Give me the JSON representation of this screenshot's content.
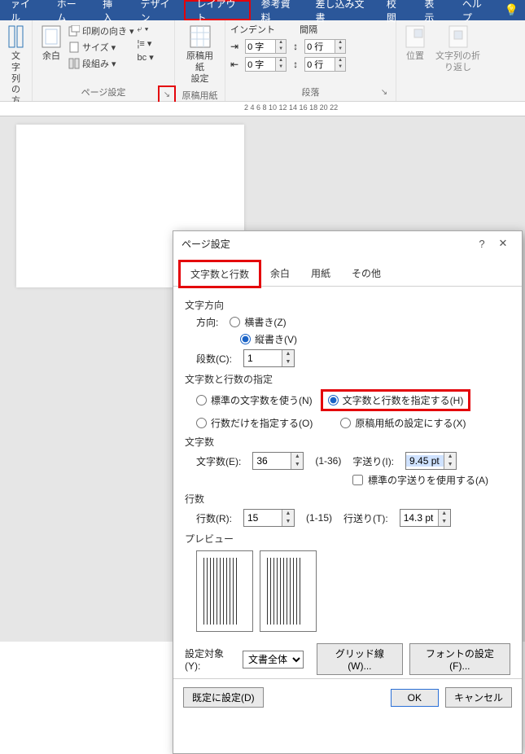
{
  "ribbon_tabs": {
    "file": "ァイル",
    "home": "ホーム",
    "insert": "挿入",
    "design": "デザイン",
    "layout": "レイアウト",
    "references": "参考資料",
    "mailings": "差し込み文書",
    "review": "校閲",
    "view": "表示",
    "help": "ヘルプ"
  },
  "ribbon": {
    "textdir_group": {
      "btn1": "文字列の",
      "btn2": "方向"
    },
    "margins": "余白",
    "orientation": "印刷の向き",
    "size": "サイズ",
    "columns": "段組み",
    "breaks": "",
    "genkou": {
      "l1": "原稿用紙",
      "l2": "設定"
    },
    "page_setup_title": "ページ設定",
    "genkou_title": "原稿用紙",
    "indent_title": "インデント",
    "spacing_title": "間隔",
    "para_title": "段落",
    "indent_left": "0 字",
    "indent_right": "0 字",
    "space_before": "0 行",
    "space_after": "0 行",
    "position": "位置",
    "wrap": {
      "l1": "文字列の折",
      "l2": "り返し"
    }
  },
  "ruler": {
    "marks": "2       4       6       8      10      12      14      16      18     20     22"
  },
  "dialog": {
    "title": "ページ設定",
    "tabs": {
      "grid": "文字数と行数",
      "margins": "余白",
      "paper": "用紙",
      "other": "その他"
    },
    "sect_textdir": "文字方向",
    "direction_label": "方向:",
    "horizontal": "横書き(Z)",
    "vertical": "縦書き(V)",
    "columns_label": "段数(C):",
    "columns_value": "1",
    "sect_spec": "文字数と行数の指定",
    "opt_std": "標準の文字数を使う(N)",
    "opt_chars_lines": "文字数と行数を指定する(H)",
    "opt_lines_only": "行数だけを指定する(O)",
    "opt_genkou": "原稿用紙の設定にする(X)",
    "sect_chars": "文字数",
    "chars_label": "文字数(E):",
    "chars_value": "36",
    "chars_range": "(1-36)",
    "pitch_label": "字送り(I):",
    "pitch_value": "9.45 pt",
    "use_std_pitch": "標準の字送りを使用する(A)",
    "sect_lines": "行数",
    "lines_label": "行数(R):",
    "lines_value": "15",
    "lines_range": "(1-15)",
    "linepitch_label": "行送り(T):",
    "linepitch_value": "14.3 pt",
    "sect_preview": "プレビュー",
    "apply_label": "設定対象(Y):",
    "apply_value": "文書全体",
    "grid_btn": "グリッド線(W)...",
    "font_btn": "フォントの設定(F)...",
    "default_btn": "既定に設定(D)",
    "ok": "OK",
    "cancel": "キャンセル"
  }
}
